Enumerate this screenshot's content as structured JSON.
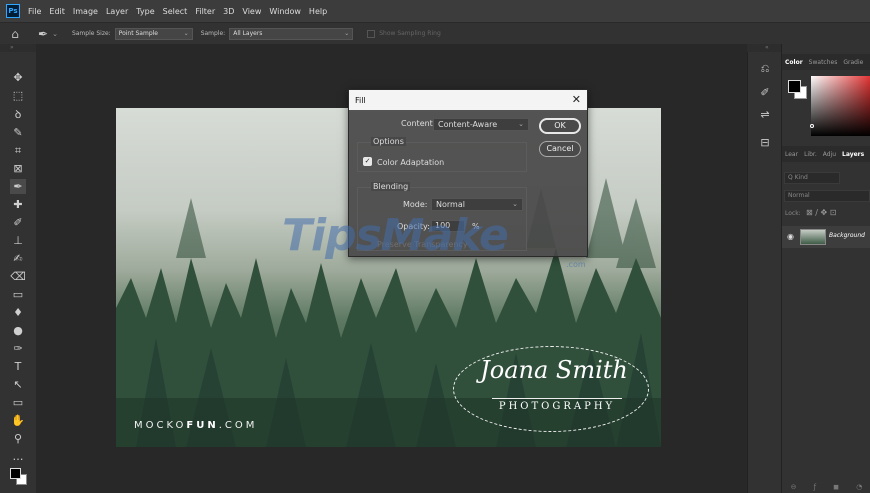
{
  "app": {
    "logo": "Ps"
  },
  "menu": [
    "File",
    "Edit",
    "Image",
    "Layer",
    "Type",
    "Select",
    "Filter",
    "3D",
    "View",
    "Window",
    "Help"
  ],
  "options_bar": {
    "sample_size_label": "Sample Size:",
    "sample_size_value": "Point Sample",
    "sample_label": "Sample:",
    "sample_value": "All Layers",
    "show_sampling_ring": "Show Sampling Ring"
  },
  "tools": [
    {
      "name": "move-tool-icon",
      "glyph": "✥"
    },
    {
      "name": "marquee-tool-icon",
      "glyph": "⬚"
    },
    {
      "name": "lasso-tool-icon",
      "glyph": "ꝺ"
    },
    {
      "name": "quick-select-tool-icon",
      "glyph": "✎"
    },
    {
      "name": "crop-tool-icon",
      "glyph": "⌗"
    },
    {
      "name": "frame-tool-icon",
      "glyph": "⊠"
    },
    {
      "name": "eyedropper-tool-icon",
      "glyph": "✒"
    },
    {
      "name": "healing-brush-tool-icon",
      "glyph": "✚"
    },
    {
      "name": "brush-tool-icon",
      "glyph": "✐"
    },
    {
      "name": "clone-stamp-tool-icon",
      "glyph": "⊥"
    },
    {
      "name": "history-brush-tool-icon",
      "glyph": "✍"
    },
    {
      "name": "eraser-tool-icon",
      "glyph": "⌫"
    },
    {
      "name": "gradient-tool-icon",
      "glyph": "▭"
    },
    {
      "name": "blur-tool-icon",
      "glyph": "♦"
    },
    {
      "name": "dodge-tool-icon",
      "glyph": "●"
    },
    {
      "name": "pen-tool-icon",
      "glyph": "✑"
    },
    {
      "name": "type-tool-icon",
      "glyph": "T"
    },
    {
      "name": "path-select-tool-icon",
      "glyph": "↖"
    },
    {
      "name": "rectangle-tool-icon",
      "glyph": "▭"
    },
    {
      "name": "hand-tool-icon",
      "glyph": "✋"
    },
    {
      "name": "zoom-tool-icon",
      "glyph": "⚲"
    },
    {
      "name": "more-tools-icon",
      "glyph": "…"
    }
  ],
  "canvas": {
    "brand": "MOCKOFUN.COM",
    "brand_part1": "MOCKO",
    "brand_part2": "FUN",
    "brand_part3": ".COM",
    "signature_name": "Joana Smith",
    "signature_sub": "PHOTOGRAPHY"
  },
  "watermark": {
    "text": "TipsMake",
    "domain": ".com"
  },
  "fill_dialog": {
    "title": "Fill",
    "contents_label": "Contents:",
    "contents_value": "Content-Aware",
    "options_label": "Options",
    "color_adaptation": "Color Adaptation",
    "color_adaptation_checked": true,
    "blending_label": "Blending",
    "mode_label": "Mode:",
    "mode_value": "Normal",
    "opacity_label": "Opacity:",
    "opacity_value": "100",
    "opacity_unit": "%",
    "preserve_transparency": "Preserve Transparency",
    "ok_label": "OK",
    "cancel_label": "Cancel"
  },
  "panels": {
    "color_tabs": [
      "Color",
      "Swatches",
      "Gradie"
    ],
    "layer_tabs": [
      "Lear",
      "Libr.",
      "Adju",
      "Layers"
    ],
    "kind_placeholder": "Q Kind",
    "blend_mode": "Normal",
    "lock_label": "Lock:",
    "layer_name": "Background"
  }
}
